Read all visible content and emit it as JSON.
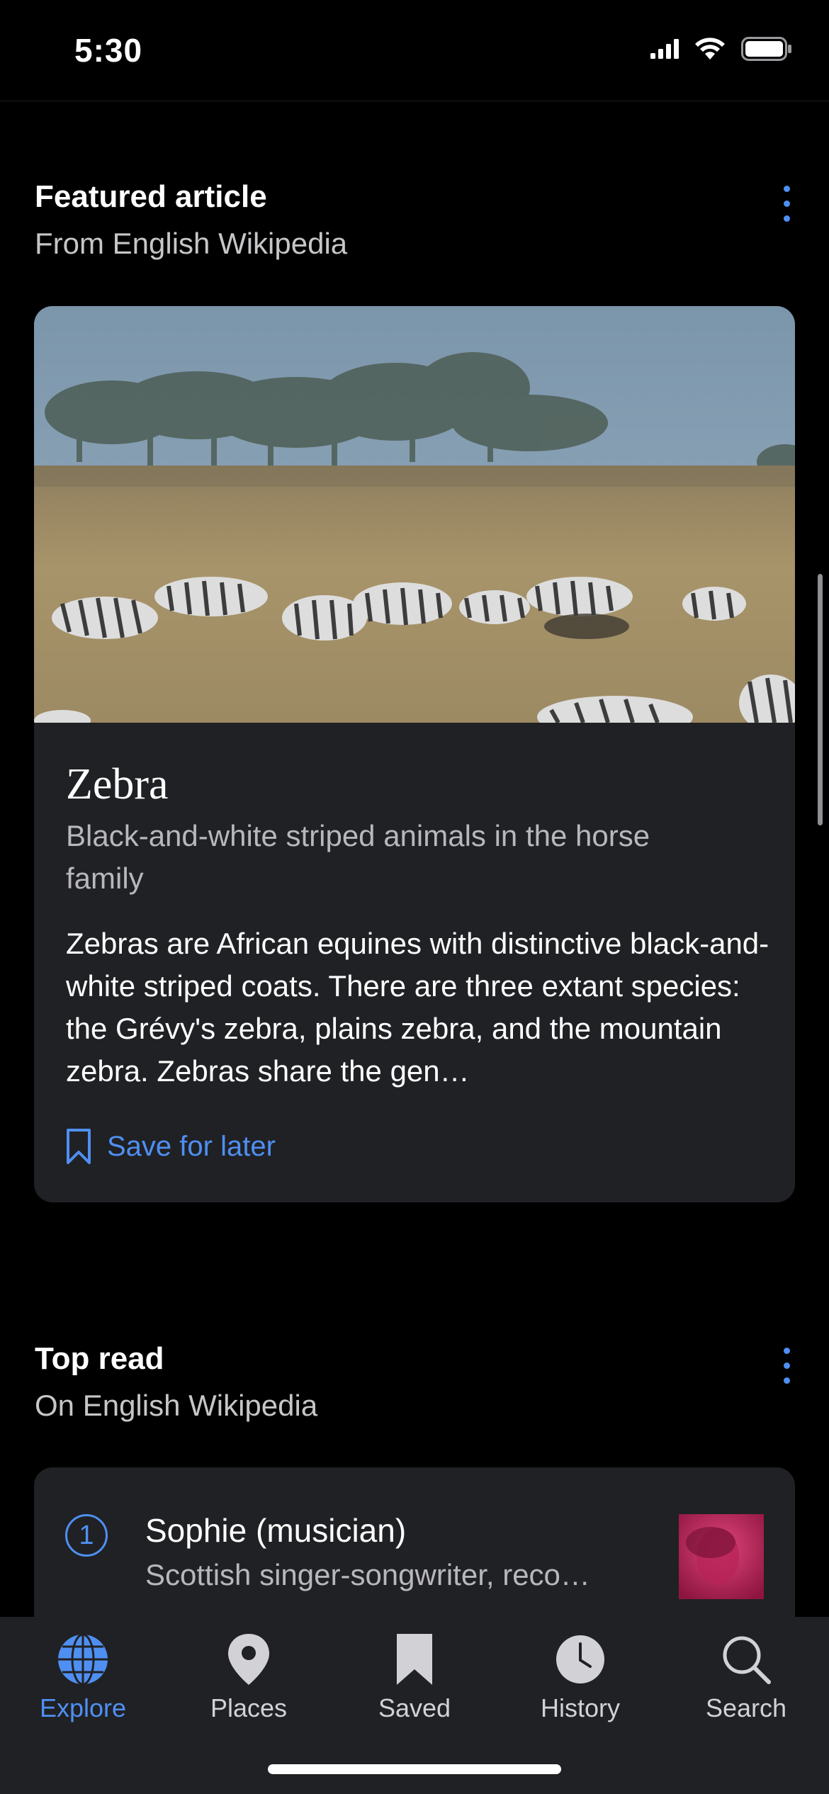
{
  "status": {
    "time": "5:30"
  },
  "featured": {
    "title": "Featured article",
    "subtitle": "From English Wikipedia",
    "article_title": "Zebra",
    "description": "Black-and-white striped animals in the horse family",
    "extract": "Zebras are African equines with distinctive black-and-white striped coats. There are three extant species: the Grévy's zebra, plains zebra, and the mountain zebra. Zebras share the gen…",
    "save_label": "Save for later"
  },
  "top_read": {
    "title": "Top read",
    "subtitle": "On English Wikipedia",
    "items": [
      {
        "rank": "1",
        "title": "Sophie (musician)",
        "description": "Scottish singer-songwriter, reco…"
      }
    ]
  },
  "tabs": [
    {
      "label": "Explore",
      "icon": "globe-icon",
      "active": true
    },
    {
      "label": "Places",
      "icon": "map-pin-icon",
      "active": false
    },
    {
      "label": "Saved",
      "icon": "bookmark-icon",
      "active": false
    },
    {
      "label": "History",
      "icon": "clock-icon",
      "active": false
    },
    {
      "label": "Search",
      "icon": "magnifier-icon",
      "active": false
    }
  ],
  "colors": {
    "accent": "#4f8ff2",
    "background": "#000000",
    "card": "#202124"
  }
}
